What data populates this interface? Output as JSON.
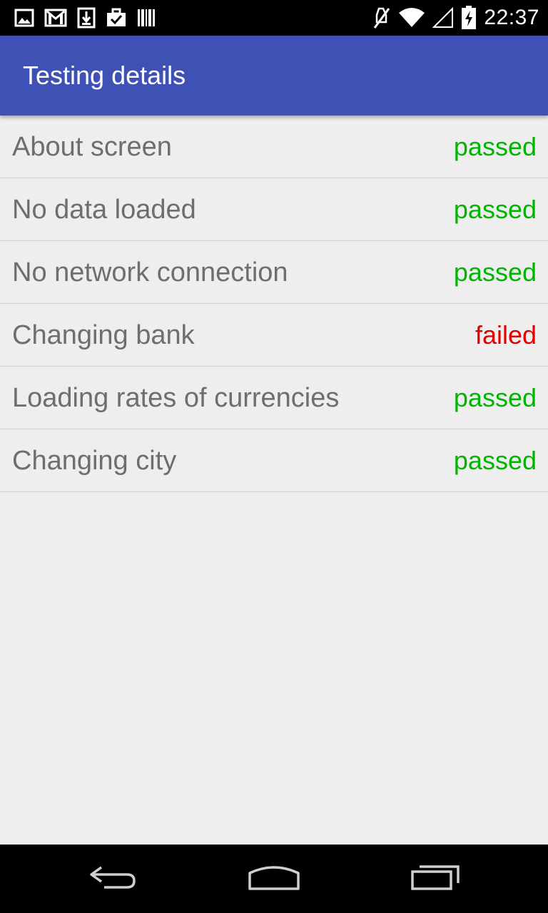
{
  "status_bar": {
    "time": "22:37",
    "left_icons": [
      "image-icon",
      "gmail-icon",
      "download-icon",
      "briefcase-check-icon",
      "barcode-icon"
    ],
    "right_icons": [
      "silent-mode-icon",
      "wifi-icon",
      "signal-icon",
      "battery-charging-icon"
    ]
  },
  "app_bar": {
    "title": "Testing details",
    "color": "#3f51b5"
  },
  "tests": [
    {
      "label": "About screen",
      "status": "passed"
    },
    {
      "label": "No data loaded",
      "status": "passed"
    },
    {
      "label": "No network connection",
      "status": "passed"
    },
    {
      "label": "Changing bank",
      "status": "failed"
    },
    {
      "label": "Loading rates of currencies",
      "status": "passed"
    },
    {
      "label": "Changing city",
      "status": "passed"
    }
  ],
  "colors": {
    "passed": "#00b400",
    "failed": "#e00000",
    "label": "#6e6e6e",
    "background": "#eeeeee"
  },
  "nav_bar": {
    "buttons": [
      "back-icon",
      "home-icon",
      "recent-apps-icon"
    ]
  }
}
